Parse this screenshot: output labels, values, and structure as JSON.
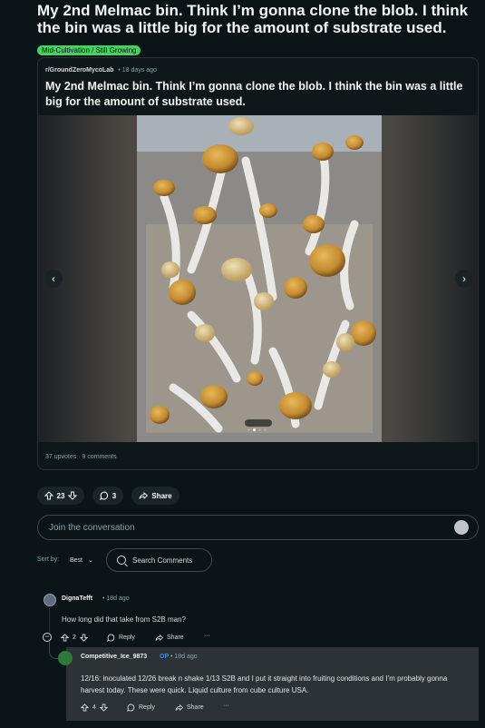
{
  "post": {
    "title": "My 2nd Melmac bin. Think I’m gonna clone the blob. I think the bin was a little big for the amount of substrate used.",
    "flair": "Mid-Cultivation / Still Growing"
  },
  "crosspost": {
    "subreddit": "r/GroundZeroMycoLab",
    "age": "• 18 days ago",
    "title": "My 2nd Melmac bin. Think I’m gonna clone the blob. I think the bin was a little big for the amount of substrate used.",
    "upvotes": "37 upvotes",
    "separator": "·",
    "comments": "9 comments",
    "gallery_active_index": 1,
    "gallery_count": 4
  },
  "actions": {
    "vote_count": "23",
    "comment_count": "3",
    "share_label": "Share"
  },
  "composer": {
    "placeholder": "Join the conversation"
  },
  "sort": {
    "label": "Sort by:",
    "value": "Best"
  },
  "search": {
    "placeholder": "Search Comments"
  },
  "comments": [
    {
      "user": "DignaTefft",
      "age": "• 18d ago",
      "body": "How long did that take from S2B man?",
      "votes": "2",
      "reply_label": "Reply",
      "share_label": "Share",
      "more": "···"
    },
    {
      "user": "Competitive_Ice_9873",
      "op_badge": "OP",
      "age": "• 18d ago",
      "body": "12/16: inoculated 12/26 break n shake 1/13 S2B and I put it straight into fruiting conditions and I’m probably gonna harvest today. These were quick. Liquid culture from cube culture USA.",
      "votes": "4",
      "reply_label": "Reply",
      "share_label": "Share",
      "more": "···"
    }
  ],
  "colors": {
    "background": "#0b1416",
    "flair": "#46d160",
    "op_badge": "#3f8fe6",
    "reply_box": "#2c3235"
  }
}
